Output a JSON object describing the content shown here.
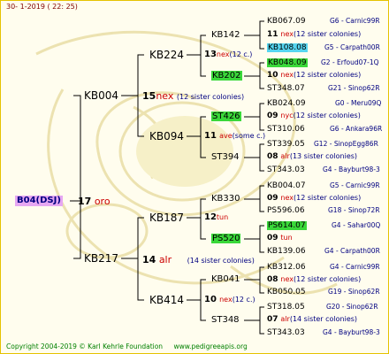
{
  "header": {
    "date": "30-  1-2019  ( 22: 25)"
  },
  "root": {
    "id": "B04(DSJ)",
    "num": "17",
    "breed": "oro"
  },
  "level1": [
    {
      "id": "KB004",
      "num": "15",
      "breed": "nex",
      "sisters": "(12 sister colonies)"
    },
    {
      "id": "KB217",
      "num": "14",
      "breed": "alr",
      "sisters": "(14 sister colonies)"
    }
  ],
  "level2": [
    {
      "id": "KB224",
      "num": "13",
      "breed": "nex",
      "note": "(12 c.)"
    },
    {
      "id": "KB094",
      "num": "11",
      "breed": "ave",
      "note": "(some c.)"
    },
    {
      "id": "KB187",
      "num": "12",
      "breed": "tun",
      "note": ""
    },
    {
      "id": "KB414",
      "num": "10",
      "breed": "nex",
      "note": "(12 c.)"
    }
  ],
  "level3": [
    {
      "id": "KB142",
      "highlight": ""
    },
    {
      "id": "KB202",
      "highlight": "green"
    },
    {
      "id": "ST426",
      "highlight": "green"
    },
    {
      "id": "ST394",
      "highlight": ""
    },
    {
      "id": "KB330",
      "highlight": ""
    },
    {
      "id": "PS520",
      "highlight": "green"
    },
    {
      "id": "KB041",
      "highlight": ""
    },
    {
      "id": "ST348",
      "highlight": ""
    }
  ],
  "level4": [
    {
      "id": "KB067.09",
      "location": "G6 - Carnic99R",
      "highlight": ""
    },
    {
      "num": "11",
      "breed": "nex",
      "sisters": "(12 sister colonies)"
    },
    {
      "id": "KB108.08",
      "location": "G5 - Carpath00R",
      "highlight": "cyan"
    },
    {
      "id": "KB048.09",
      "location": "G2 - Erfoud07-1Q",
      "highlight": "green"
    },
    {
      "num": "10",
      "breed": "nex",
      "sisters": "(12 sister colonies)"
    },
    {
      "id": "ST348.07",
      "location": "G21 - Sinop62R",
      "highlight": ""
    },
    {
      "id": "KB024.09",
      "location": "G0 - Meru09Q",
      "highlight": ""
    },
    {
      "num": "09",
      "breed": "nyc",
      "sisters": "(12 sister colonies)"
    },
    {
      "id": "ST310.06",
      "location": "G6 - Ankara96R",
      "highlight": ""
    },
    {
      "id": "ST339.05",
      "location": "G12 - SinopEgg86R",
      "highlight": ""
    },
    {
      "num": "08",
      "breed": "alr",
      "sisters": "(13 sister colonies)"
    },
    {
      "id": "ST343.03",
      "location": "G4 - Bayburt98-3",
      "highlight": ""
    },
    {
      "id": "KB004.07",
      "location": "G5 - Carnic99R",
      "highlight": ""
    },
    {
      "num": "09",
      "breed": "nex",
      "sisters": "(12 sister colonies)"
    },
    {
      "id": "PS596.06",
      "location": "G18 - Sinop72R",
      "highlight": ""
    },
    {
      "id": "PS614.07",
      "location": "G4 - Sahar00Q",
      "highlight": "green"
    },
    {
      "num": "09",
      "breed": "tun",
      "sisters": ""
    },
    {
      "id": "KB139.06",
      "location": "G4 - Carpath00R",
      "highlight": ""
    },
    {
      "id": "KB312.06",
      "location": "G4 - Carnic99R",
      "highlight": ""
    },
    {
      "num": "08",
      "breed": "nex",
      "sisters": "(12 sister colonies)"
    },
    {
      "id": "KB050.05",
      "location": "G19 - Sinop62R",
      "highlight": ""
    },
    {
      "id": "ST318.05",
      "location": "G20 - Sinop62R",
      "highlight": ""
    },
    {
      "num": "07",
      "breed": "alr",
      "sisters": "(14 sister colonies)"
    },
    {
      "id": "ST343.03",
      "location": "G4 - Bayburt98-3",
      "highlight": ""
    }
  ],
  "footer": {
    "copyright": "Copyright 2004-2019 © Karl Kehrle Foundation",
    "url": "www.pedigreeapis.org"
  }
}
